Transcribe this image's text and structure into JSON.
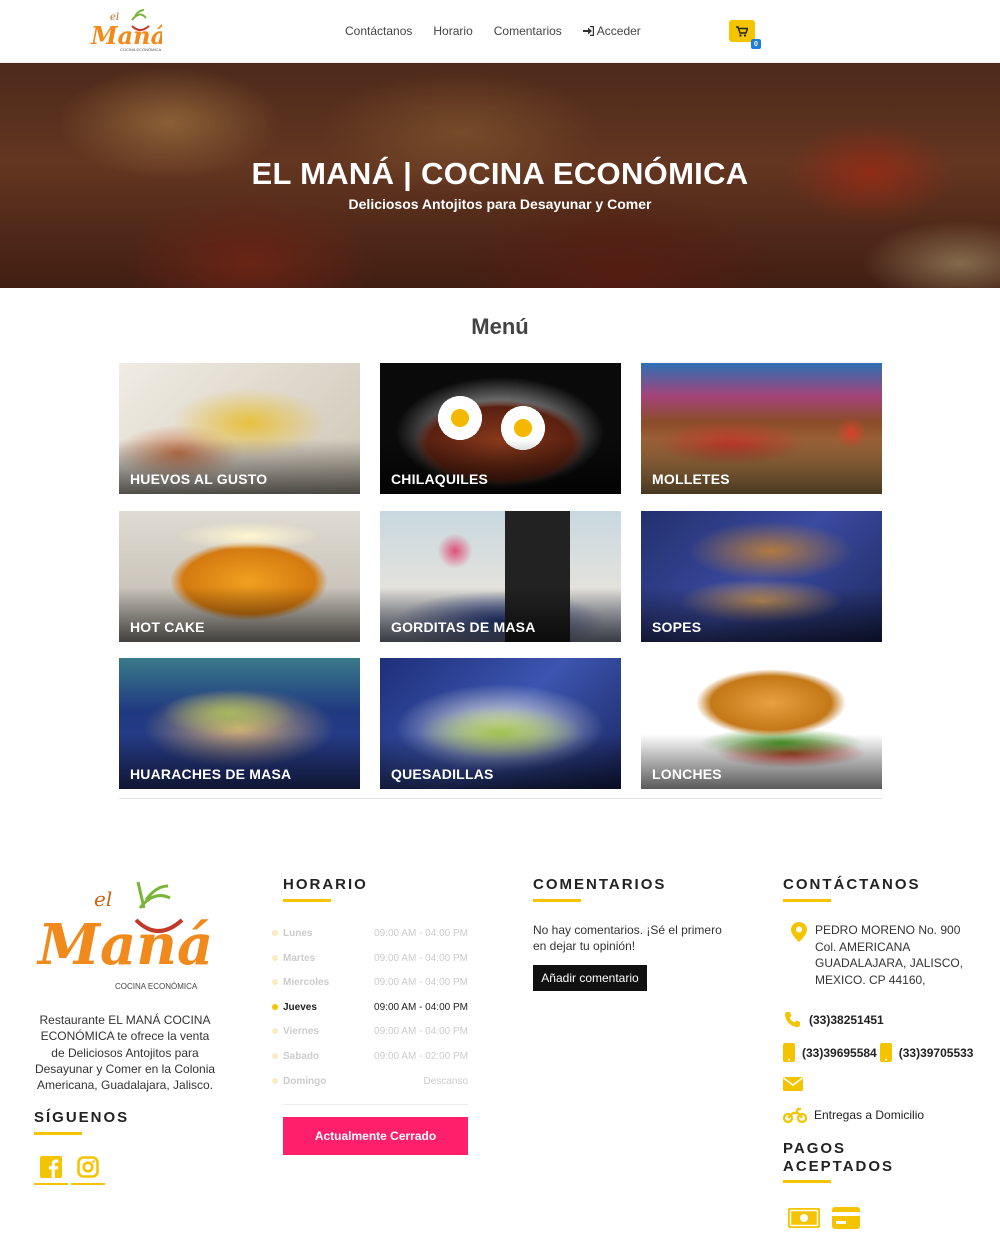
{
  "nav": {
    "logo_text_top": "el",
    "logo_text_main": "Maná",
    "logo_text_sub": "COCINA ECONÓMICA",
    "links": [
      "Contáctanos",
      "Horario",
      "Comentarios"
    ],
    "login_label": "Acceder",
    "cart_count": "0"
  },
  "hero": {
    "title": "EL MANÁ | COCINA ECONÓMICA",
    "subtitle": "Deliciosos Antojitos para Desayunar y Comer"
  },
  "menu": {
    "title": "Menú",
    "items": [
      "HUEVOS AL GUSTO",
      "CHILAQUILES",
      "MOLLETES",
      "HOT CAKE",
      "GORDITAS DE MASA",
      "SOPES",
      "HUARACHES DE MASA",
      "QUESADILLAS",
      "LONCHES"
    ]
  },
  "footer": {
    "logo_text_top": "el",
    "logo_text_main": "Maná",
    "logo_text_sub": "COCINA ECONÓMICA",
    "about": "Restaurante EL MANÁ COCINA ECONÓMICA te ofrece la venta de Deliciosos Antojitos para Desayunar y Comer en la Colonia Americana, Guadalajara, Jalisco.",
    "follow_title": "SÍGUENOS",
    "schedule_title": "HORARIO",
    "schedule": [
      {
        "day": "Lunes",
        "time": "09:00 AM - 04:00 PM"
      },
      {
        "day": "Martes",
        "time": "09:00 AM - 04:00 PM"
      },
      {
        "day": "Miercoles",
        "time": "09:00 AM - 04:00 PM"
      },
      {
        "day": "Jueves",
        "time": "09:00 AM - 04:00 PM"
      },
      {
        "day": "Viernes",
        "time": "09:00 AM - 04:00 PM"
      },
      {
        "day": "Sabado",
        "time": "09:00 AM - 02:00 PM"
      },
      {
        "day": "Domingo",
        "time": "Descanso"
      }
    ],
    "status_button": "Actualmente Cerrado",
    "comments_title": "COMENTARIOS",
    "comments_text": "No hay comentarios. ¡Sé el primero en dejar tu opinión!",
    "comments_button": "Añadir comentario",
    "contact_title": "CONTÁCTANOS",
    "address": "PEDRO MORENO No. 900 Col. AMERICANA GUADALAJARA, JALISCO, MEXICO. CP 44160,",
    "phone": "(33)38251451",
    "mobile1": "(33)39695584",
    "mobile2": "(33)39705533",
    "delivery": "Entregas a Domicilio",
    "payments_title_1": "PAGOS",
    "payments_title_2": "ACEPTADOS"
  },
  "colors": {
    "accent": "#f5c400",
    "closed": "#ff1f6b",
    "logo_orange": "#f08a1c",
    "logo_green": "#7ab53b"
  }
}
